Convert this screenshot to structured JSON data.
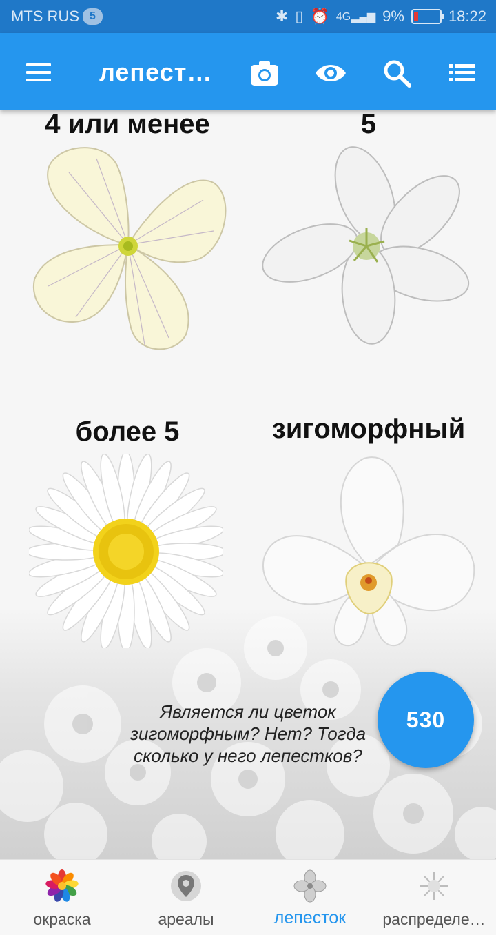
{
  "status_bar": {
    "carrier": "MTS RUS",
    "notification_count": "5",
    "battery": "9%",
    "time": "18:22"
  },
  "app_bar": {
    "title": "лепест…",
    "icons": [
      "menu-icon",
      "camera-icon",
      "eye-icon",
      "search-icon",
      "list-icon"
    ]
  },
  "options": [
    {
      "label": "4 или менее"
    },
    {
      "label": "5"
    },
    {
      "label": "более 5"
    },
    {
      "label": "зигоморфный"
    }
  ],
  "question": {
    "line1": "Является ли цветок",
    "line2": "зигоморфным? Нет? Тогда",
    "line3": "сколько у него лепестков?"
  },
  "fab_count": "530",
  "bottom_nav": {
    "items": [
      {
        "label": "окраска",
        "active": false
      },
      {
        "label": "ареалы",
        "active": false
      },
      {
        "label": "лепесток",
        "active": true
      },
      {
        "label": "распределе…",
        "active": false
      }
    ]
  },
  "colors": {
    "primary": "#2596ee",
    "status_bar": "#1f78c8",
    "active_nav": "#2596ee"
  }
}
